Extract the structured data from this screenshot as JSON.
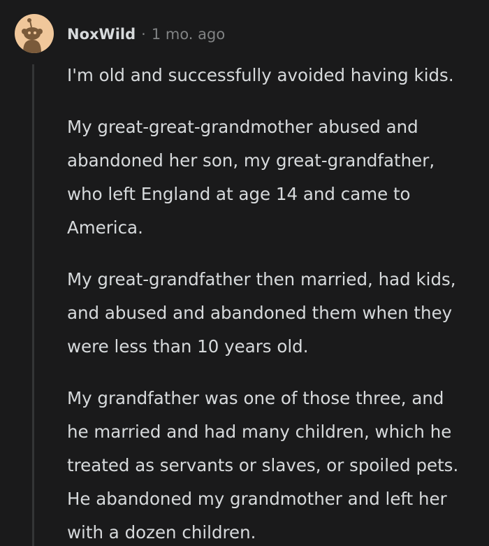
{
  "comment": {
    "author": "NoxWild",
    "separator": "·",
    "timestamp": "1 mo. ago",
    "avatar_icon": "reddit-snoo-icon",
    "paragraphs": [
      "I'm old and successfully avoided having kids.",
      "My great-great-grandmother abused and abandoned her son, my great-grandfather, who left England at age 14 and came to America.",
      "My great-grandfather then married, had kids, and abused and abandoned them when they were less than 10 years old.",
      "My grandfather was one of those three, and he married and had many children, which he treated as servants or slaves, or spoiled pets. He abandoned my grandmother and left her with a dozen children."
    ]
  },
  "colors": {
    "background": "#1a1a1b",
    "text": "#d7dadc",
    "meta": "#818384",
    "thread_line": "#343536",
    "avatar_bg": "#f0c79b",
    "avatar_figure": "#7a5a3a"
  }
}
